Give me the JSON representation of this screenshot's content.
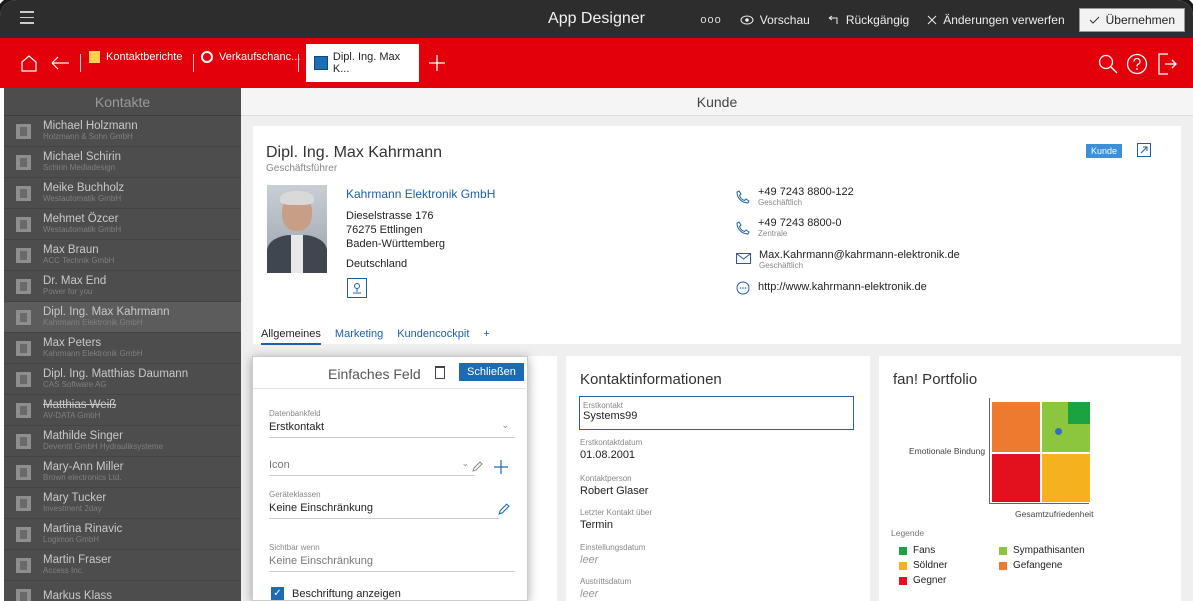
{
  "titlebar": {
    "title": "App Designer",
    "dots": "ooo",
    "preview": "Vorschau",
    "undo": "Rückgängig",
    "discard": "Änderungen verwerfen",
    "apply": "Übernehmen"
  },
  "navbar": {
    "breadcrumb1": "Kontaktberichte",
    "breadcrumb2": "Verkaufschanc...",
    "active_tab": "Dipl. Ing. Max K..."
  },
  "sidebar": {
    "title": "Kontakte",
    "contacts": [
      {
        "name": "Michael Holzmann",
        "company": "Holzmann & Sohn GmbH"
      },
      {
        "name": "Michael Schirin",
        "company": "Schirin Mediadesign"
      },
      {
        "name": "Meike Buchholz",
        "company": "Westautomatik GmbH"
      },
      {
        "name": "Mehmet Özcer",
        "company": "Westautomatik GmbH"
      },
      {
        "name": "Max Braun",
        "company": "ACC Technik GmbH"
      },
      {
        "name": "Dr. Max End",
        "company": "Power for you"
      },
      {
        "name": "Dipl. Ing. Max Kahrmann",
        "company": "Kahrmann Elektronik GmbH"
      },
      {
        "name": "Max Peters",
        "company": "Kahrmann Elektronik GmbH"
      },
      {
        "name": "Dipl. Ing. Matthias Daumann",
        "company": "CAS Software AG"
      },
      {
        "name": "Matthias Weiß",
        "company": "AV-DATA GmbH"
      },
      {
        "name": "Mathilde Singer",
        "company": "Deventit GmbH Hydrauliksysteme"
      },
      {
        "name": "Mary-Ann Miller",
        "company": "Brown electronics Ltd."
      },
      {
        "name": "Mary Tucker",
        "company": "Investment 2day"
      },
      {
        "name": "Martina Rinavic",
        "company": "Logimon GmbH"
      },
      {
        "name": "Martin Fraser",
        "company": "Access Inc."
      },
      {
        "name": "Markus Klass",
        "company": ""
      }
    ]
  },
  "main": {
    "title": "Kunde",
    "person": {
      "name": "Dipl. Ing. Max Kahrmann",
      "role": "Geschäftsführer",
      "company": "Kahrmann Elektronik GmbH",
      "street": "Dieselstrasse 176",
      "city": "76275 Ettlingen",
      "state": "Baden-Württemberg",
      "country": "Deutschland"
    },
    "badge": "Kunde",
    "contacts": [
      {
        "value": "+49 7243 8800-122",
        "sub": "Geschäftlich"
      },
      {
        "value": "+49 7243 8800-0",
        "sub": "Zentrale"
      },
      {
        "value": "Max.Kahrmann@kahrmann-elektronik.de",
        "sub": "Geschäftlich"
      },
      {
        "value": "http://www.kahrmann-elektronik.de",
        "sub": ""
      }
    ],
    "tabs": [
      "Allgemeines",
      "Marketing",
      "Kundencockpit",
      "+"
    ],
    "kontaktinfo": {
      "title": "Kontaktinformationen",
      "fields": [
        {
          "label": "Erstkontakt",
          "value": "Systems99"
        },
        {
          "label": "Erstkontaktdatum",
          "value": "01.08.2001"
        },
        {
          "label": "Kontaktperson",
          "value": "Robert Glaser"
        },
        {
          "label": "Letzter Kontakt über",
          "value": "Termin"
        },
        {
          "label": "Einstellungsdatum",
          "value": "leer"
        },
        {
          "label": "Austrittsdatum",
          "value": "leer"
        }
      ]
    },
    "portfolio": {
      "title": "fan! Portfolio",
      "ylabel": "Emotionale Bindung",
      "xlabel": "Gesamtzufriedenheit",
      "legend_title": "Legende",
      "legend": [
        {
          "label": "Fans",
          "color": "#1aa340"
        },
        {
          "label": "Sympathisanten",
          "color": "#8cc63f"
        },
        {
          "label": "Söldner",
          "color": "#f5b21c"
        },
        {
          "label": "Gefangene",
          "color": "#ee7a30"
        },
        {
          "label": "Gegner",
          "color": "#e3101d"
        }
      ]
    }
  },
  "popup": {
    "title": "Einfaches Feld",
    "close": "Schließen",
    "db_label": "Datenbankfeld",
    "db_value": "Erstkontakt",
    "icon_value": "Icon",
    "device_label": "Geräteklassen",
    "device_value": "Keine Einschränkung",
    "visible_label": "Sichtbar wenn",
    "visible_value": "Keine Einschränkung",
    "checkbox_label": "Beschriftung anzeigen"
  }
}
